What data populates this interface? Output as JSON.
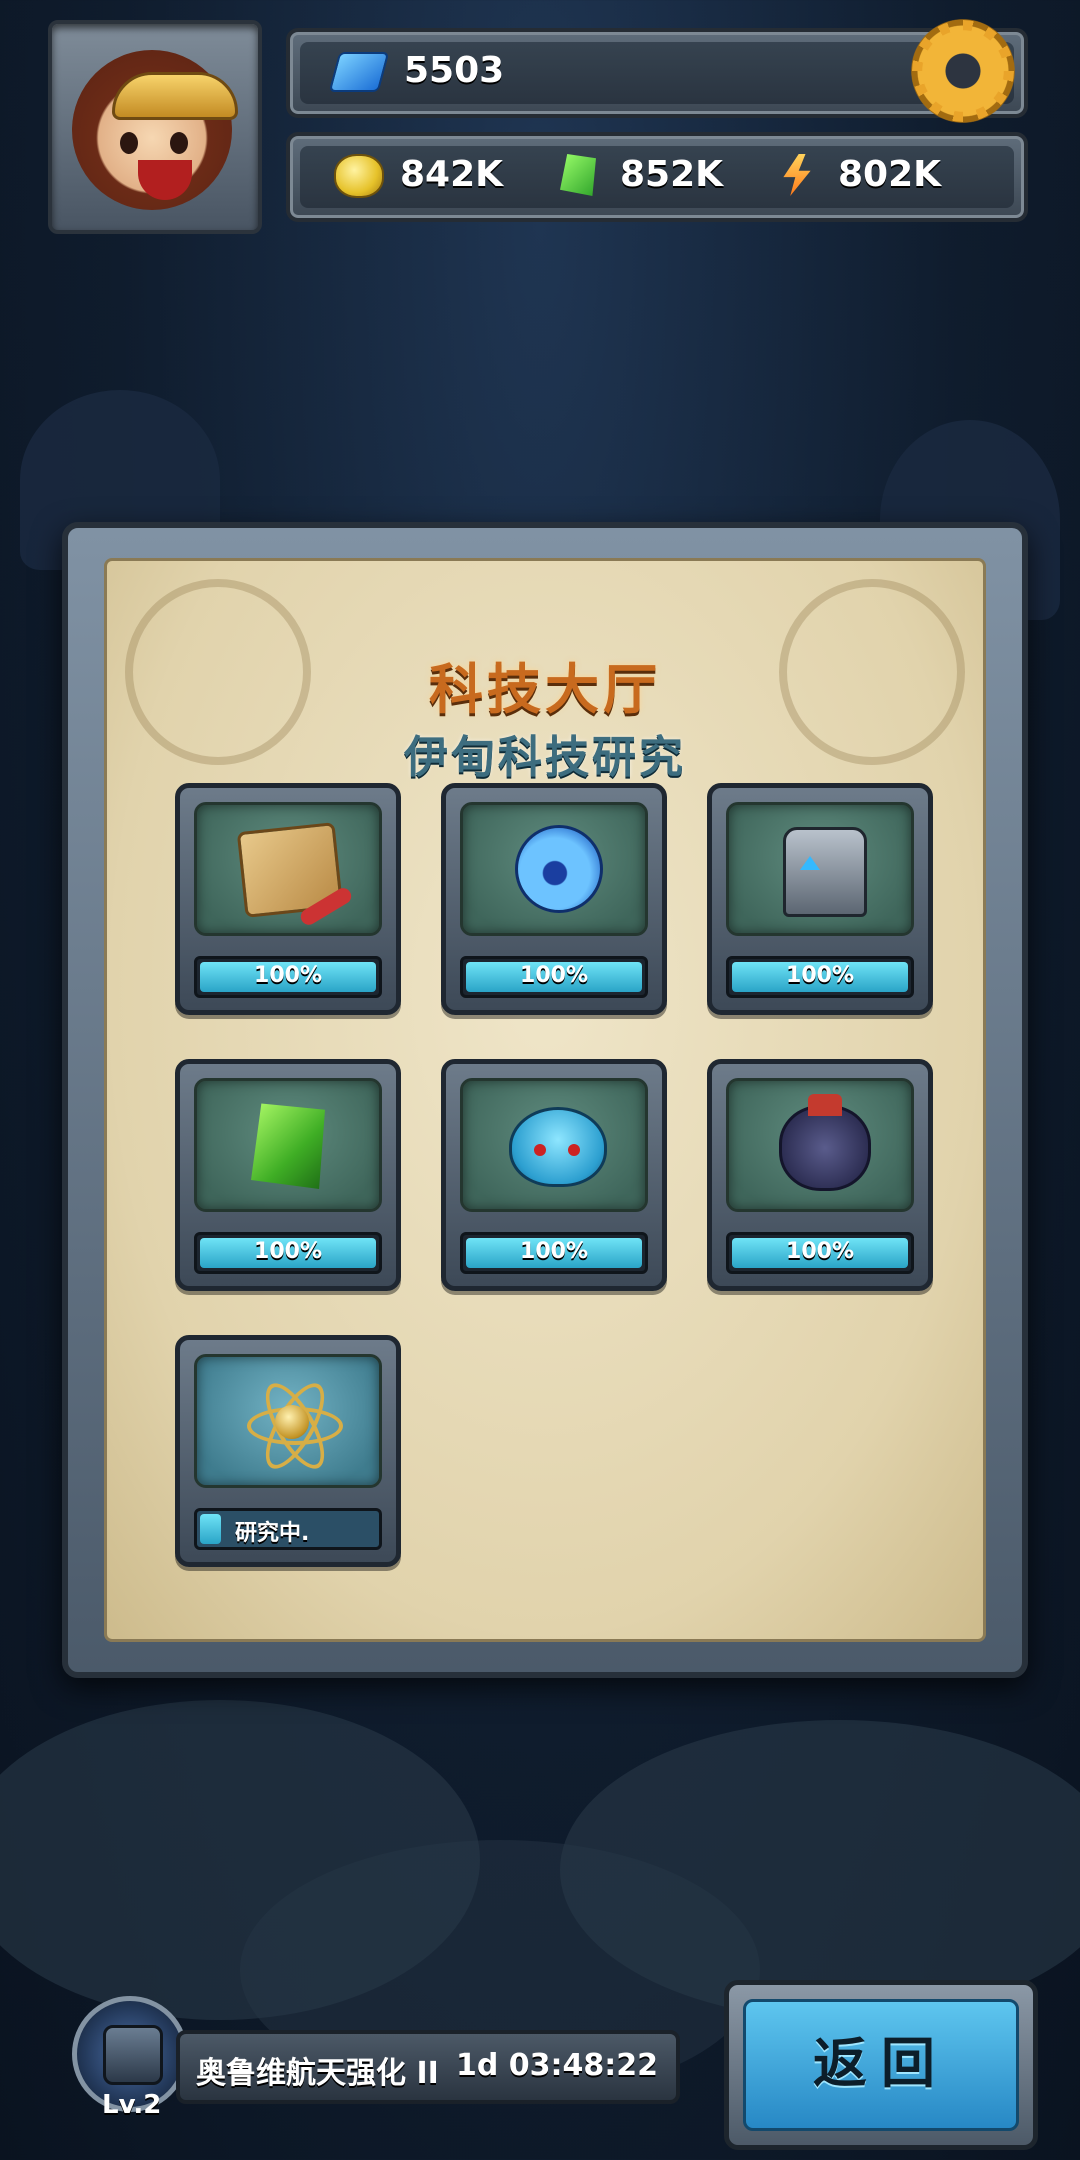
{
  "hud": {
    "gems": "5503",
    "gold": "842K",
    "crystal": "852K",
    "energy": "802K"
  },
  "panel": {
    "title": "科技大厅",
    "subtitle": "伊甸科技研究",
    "tiles": [
      {
        "icon": "map-scroll-icon",
        "status": "100%",
        "progress": 1.0
      },
      {
        "icon": "blue-orb-icon",
        "status": "100%",
        "progress": 1.0
      },
      {
        "icon": "robot-icon",
        "status": "100%",
        "progress": 1.0
      },
      {
        "icon": "green-crystal-icon",
        "status": "100%",
        "progress": 1.0
      },
      {
        "icon": "blue-blob-monster-icon",
        "status": "100%",
        "progress": 1.0
      },
      {
        "icon": "armored-monster-icon",
        "status": "100%",
        "progress": 1.0
      },
      {
        "icon": "atom-icon",
        "status": "研究中.",
        "progress": 0.15
      }
    ]
  },
  "bottom": {
    "level": "Lv.2",
    "task_name": "奥鲁维航天强化 II",
    "task_time": "1d 03:48:22",
    "back_label": "返回"
  },
  "colors": {
    "title": "#c86a1e",
    "subtitle": "#3d6d7f",
    "progress_fill": "#2aa4c7",
    "back_button": "#2788c5"
  }
}
